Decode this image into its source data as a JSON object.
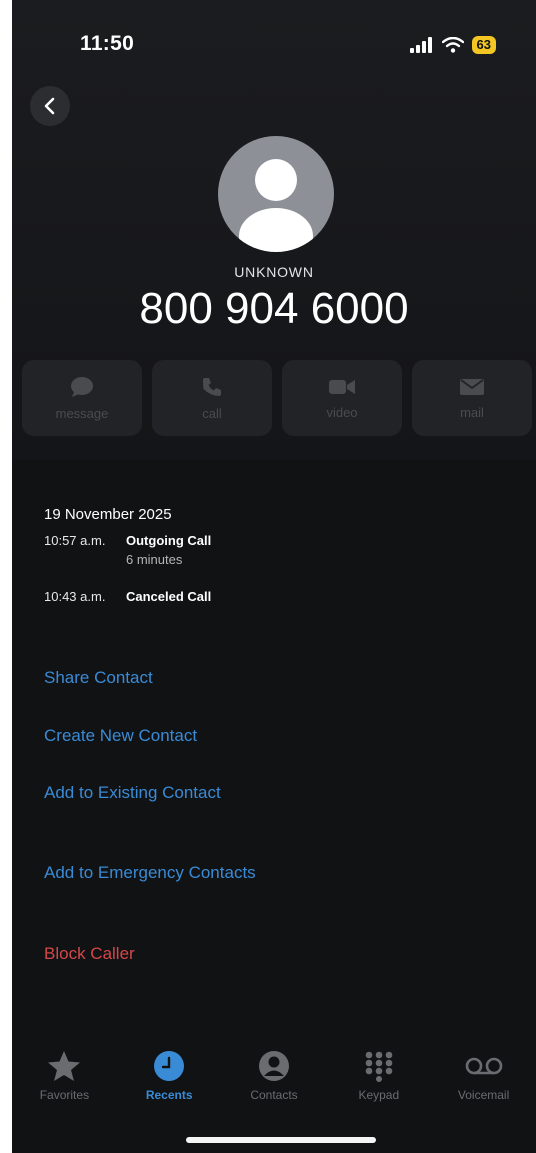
{
  "status_bar": {
    "time": "11:50",
    "battery_level": "63"
  },
  "caller": {
    "label": "UNKNOWN",
    "number": "800 904 6000"
  },
  "actions": [
    {
      "label": "message",
      "icon": "message-bubble-icon"
    },
    {
      "label": "call",
      "icon": "phone-icon"
    },
    {
      "label": "video",
      "icon": "video-camera-icon"
    },
    {
      "label": "mail",
      "icon": "envelope-icon"
    }
  ],
  "history": {
    "date": "19 November 2025",
    "calls": [
      {
        "time": "10:57 a.m.",
        "type": "Outgoing Call",
        "duration": "6 minutes"
      },
      {
        "time": "10:43 a.m.",
        "type": "Canceled Call"
      }
    ]
  },
  "options": {
    "share_contact": "Share Contact",
    "create_new_contact": "Create New Contact",
    "add_to_existing": "Add to Existing Contact",
    "add_to_emergency": "Add to Emergency Contacts",
    "block_caller": "Block Caller"
  },
  "tabs": [
    {
      "label": "Favorites",
      "icon": "star-icon"
    },
    {
      "label": "Recents",
      "icon": "clock-icon",
      "active": true
    },
    {
      "label": "Contacts",
      "icon": "person-circle-icon"
    },
    {
      "label": "Keypad",
      "icon": "keypad-icon"
    },
    {
      "label": "Voicemail",
      "icon": "voicemail-icon"
    }
  ],
  "colors": {
    "accent": "#3a8bd6",
    "destructive": "#d4474a",
    "battery": "#f3c623"
  }
}
